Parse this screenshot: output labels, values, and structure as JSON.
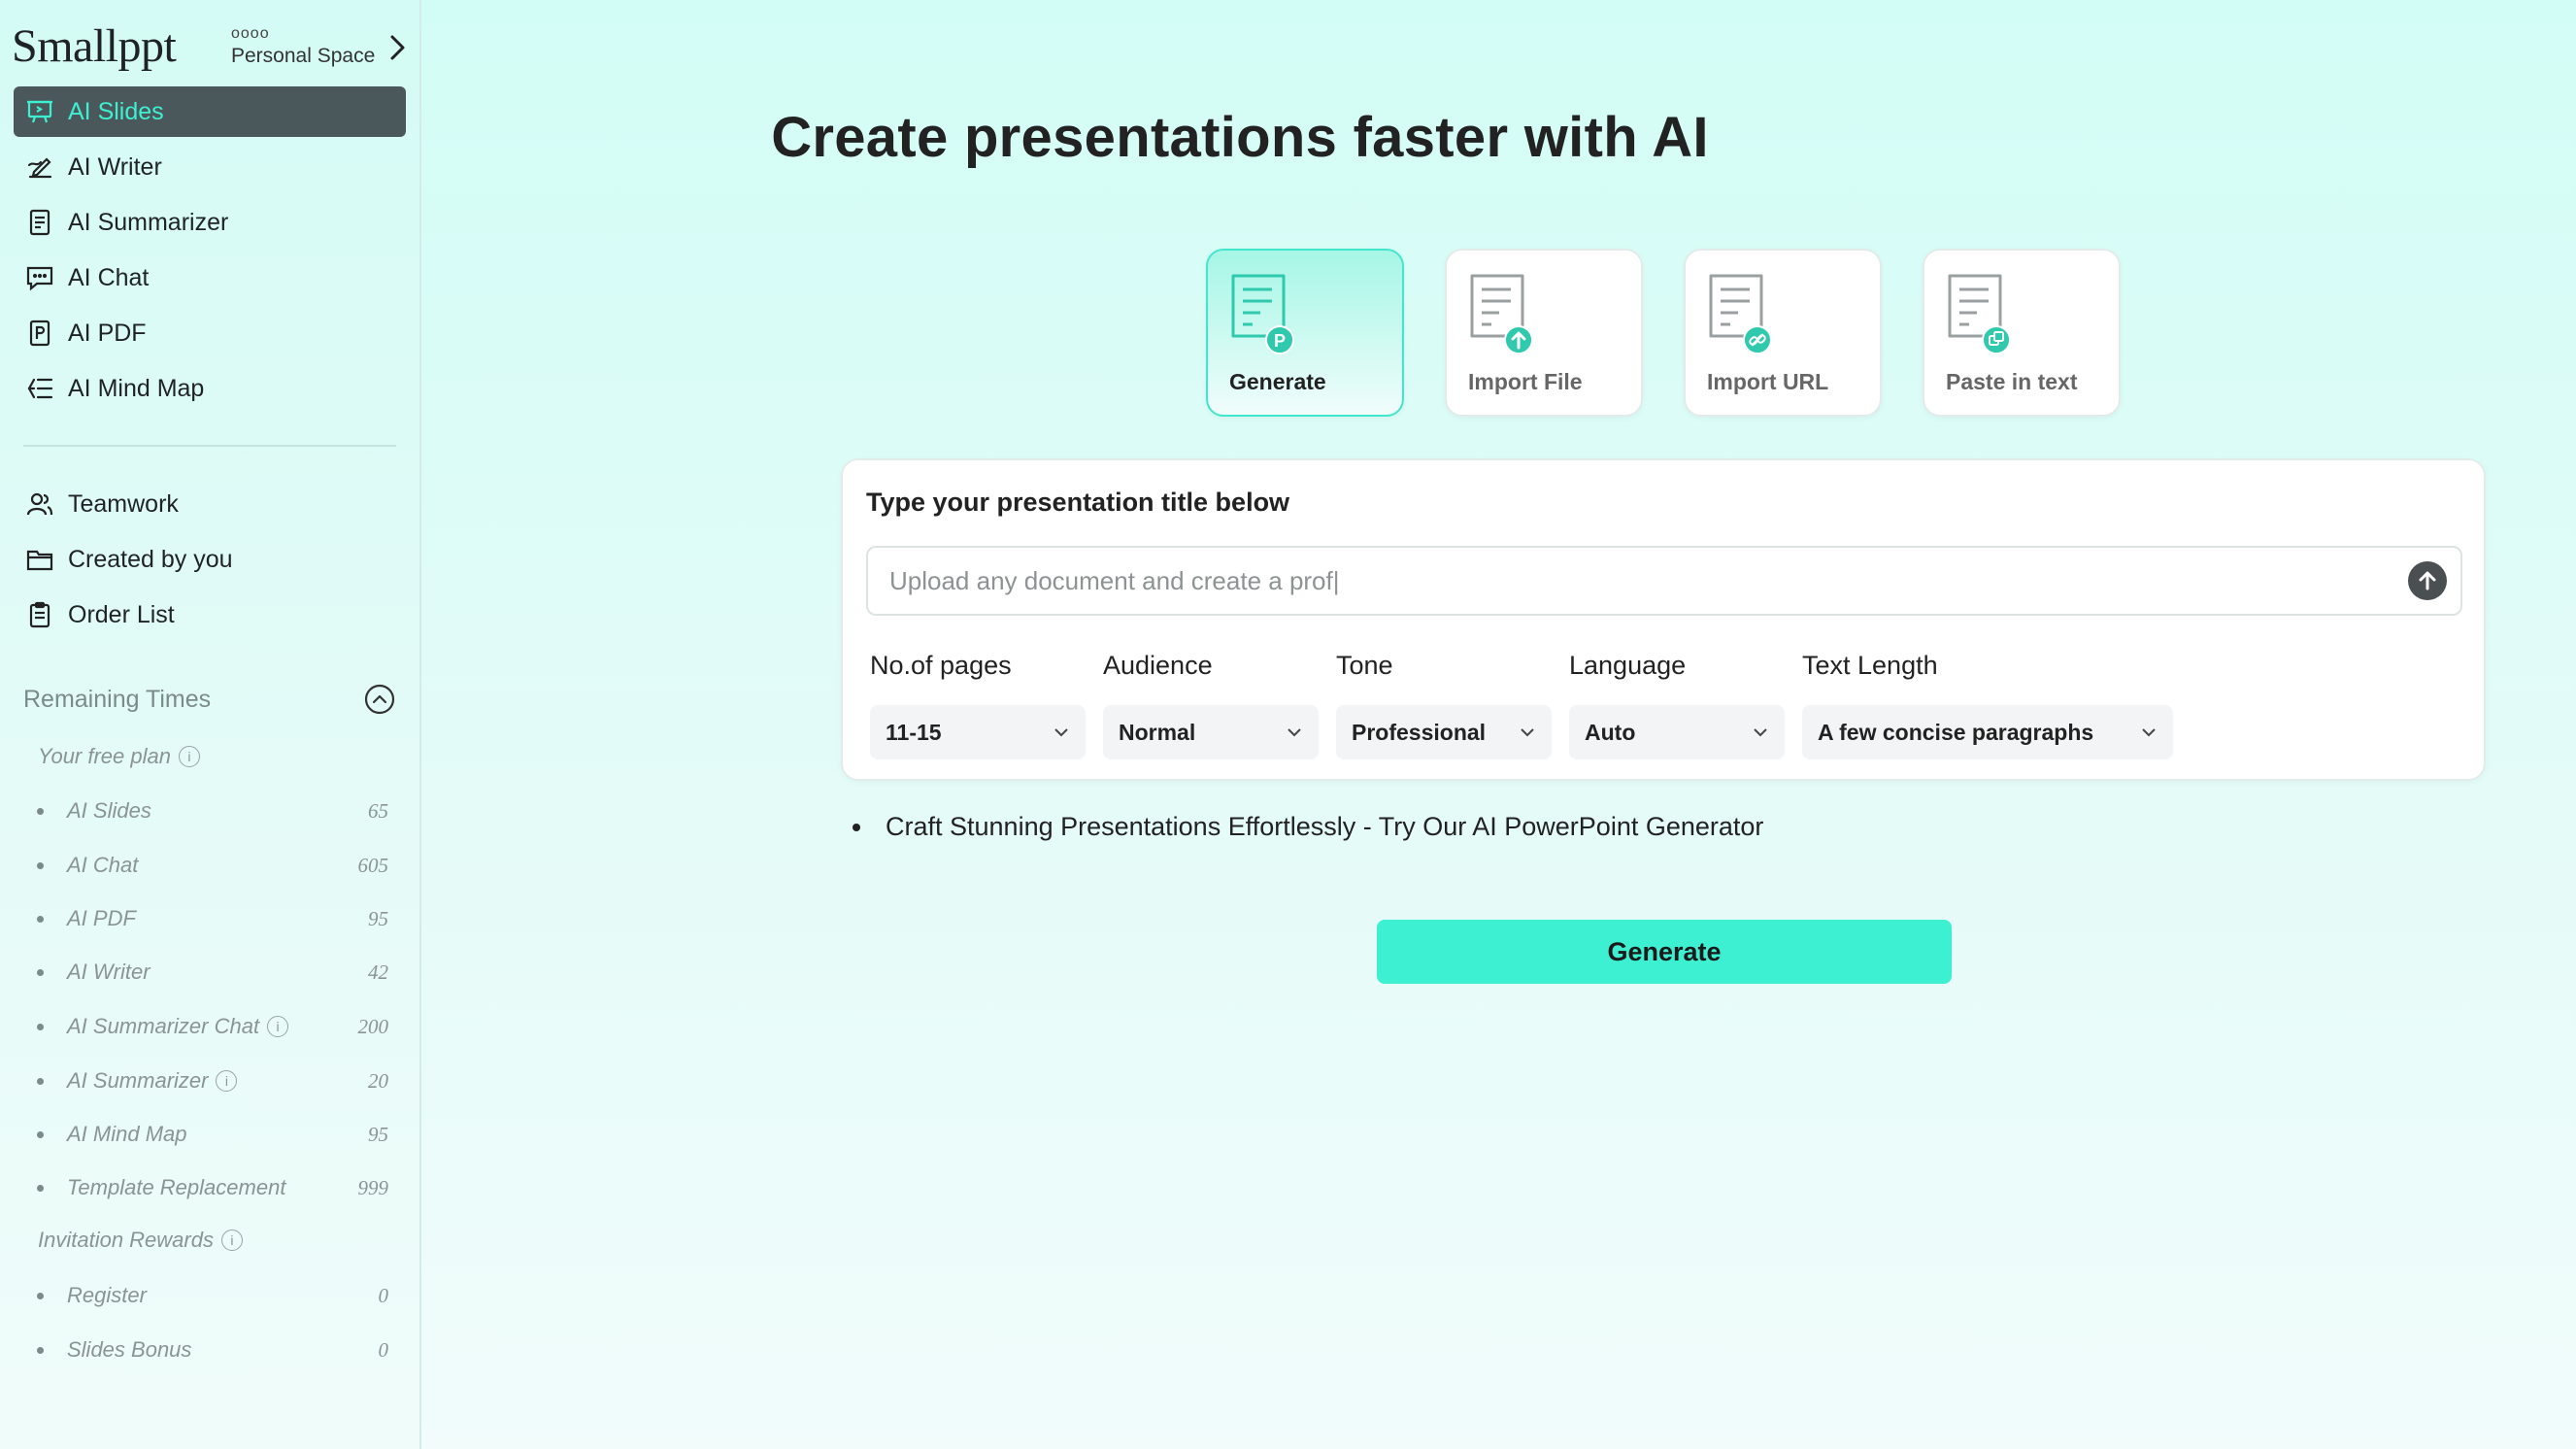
{
  "brand": {
    "logo": "Smallppt",
    "dots": "oooo",
    "workspace": "Personal Space"
  },
  "sidebar": {
    "primary": [
      {
        "label": "AI Slides",
        "icon": "slides-icon",
        "active": true
      },
      {
        "label": "AI Writer",
        "icon": "writer-icon"
      },
      {
        "label": "AI Summarizer",
        "icon": "summarizer-icon"
      },
      {
        "label": "AI Chat",
        "icon": "chat-icon"
      },
      {
        "label": "AI PDF",
        "icon": "pdf-icon"
      },
      {
        "label": "AI Mind Map",
        "icon": "mindmap-icon"
      }
    ],
    "secondary": [
      {
        "label": "Teamwork",
        "icon": "user-icon"
      },
      {
        "label": "Created by you",
        "icon": "folder-icon"
      },
      {
        "label": "Order List",
        "icon": "clipboard-icon"
      }
    ],
    "remaining_title": "Remaining Times",
    "free_plan_label": "Your free plan",
    "free_plan": [
      {
        "name": "AI Slides",
        "value": "65"
      },
      {
        "name": "AI Chat",
        "value": "605"
      },
      {
        "name": "AI PDF",
        "value": "95"
      },
      {
        "name": "AI Writer",
        "value": "42"
      },
      {
        "name": "AI Summarizer Chat",
        "value": "200",
        "info": true
      },
      {
        "name": "AI Summarizer",
        "value": "20",
        "info": true
      },
      {
        "name": "AI Mind Map",
        "value": "95"
      },
      {
        "name": "Template Replacement",
        "value": "999"
      }
    ],
    "invitation_label": "Invitation Rewards",
    "invitation": [
      {
        "name": "Register",
        "value": "0"
      },
      {
        "name": "Slides Bonus",
        "value": "0"
      }
    ]
  },
  "main": {
    "headline": "Create presentations faster with AI",
    "modes": [
      {
        "label": "Generate",
        "badge": "P",
        "active": true
      },
      {
        "label": "Import File",
        "badge": "upload"
      },
      {
        "label": "Import URL",
        "badge": "link"
      },
      {
        "label": "Paste in text",
        "badge": "copy"
      }
    ],
    "panel_title": "Type your presentation title below",
    "title_placeholder": "Upload any document and create a prof|",
    "options": [
      {
        "label": "No.of pages",
        "value": "11-15"
      },
      {
        "label": "Audience",
        "value": "Normal"
      },
      {
        "label": "Tone",
        "value": "Professional"
      },
      {
        "label": "Language",
        "value": "Auto"
      },
      {
        "label": "Text Length",
        "value": "A few concise paragraphs"
      }
    ],
    "tip": "Craft Stunning Presentations Effortlessly - Try Our AI PowerPoint Generator",
    "generate_label": "Generate"
  },
  "colors": {
    "accent": "#3ef0d2",
    "active_nav_bg": "#4a585c",
    "teal_icon": "#2fc9ae"
  }
}
